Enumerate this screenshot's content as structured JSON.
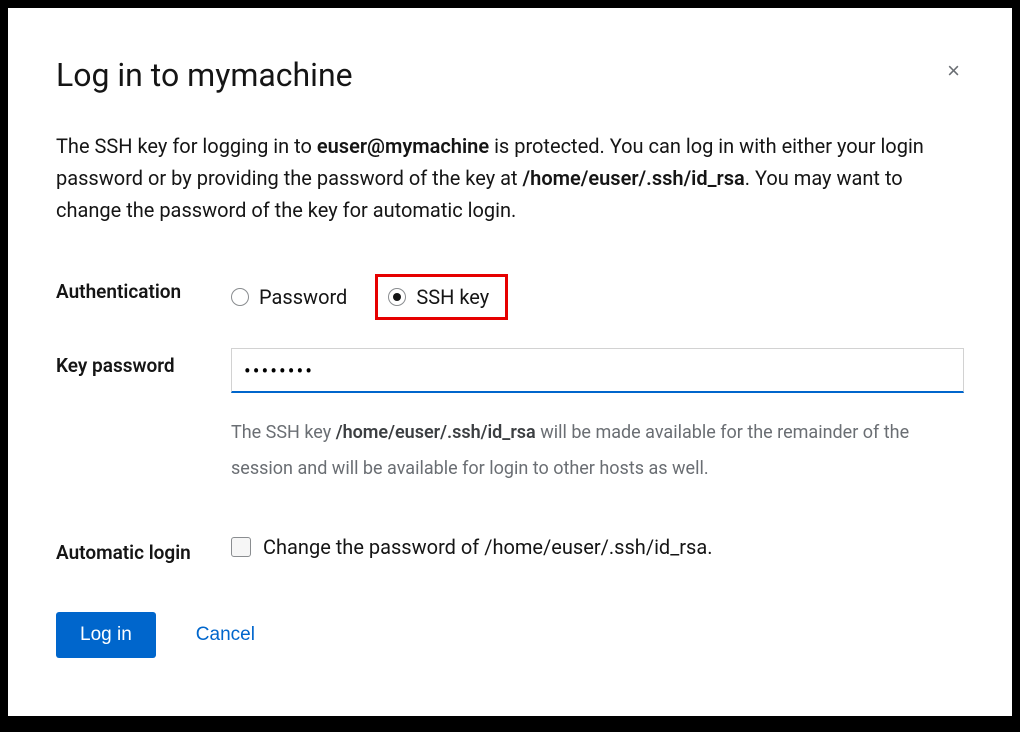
{
  "title": "Log in to mymachine",
  "close_label": "×",
  "description": {
    "prefix": "The SSH key for logging in to ",
    "userhost": "euser@mymachine",
    "mid1": " is protected. You can log in with either your login password or by providing the password of the key at ",
    "keypath": "/home/euser/.ssh/id_rsa",
    "suffix": ". You may want to change the password of the key for automatic login."
  },
  "auth": {
    "label": "Authentication",
    "option_password": "Password",
    "option_sshkey": "SSH key",
    "selected": "sshkey"
  },
  "keypw": {
    "label": "Key password",
    "value": "••••••••",
    "helper_prefix": "The SSH key ",
    "helper_path": "/home/euser/.ssh/id_rsa",
    "helper_suffix": " will be made available for the remainder of the session and will be available for login to other hosts as well."
  },
  "autologin": {
    "label": "Automatic login",
    "checkbox_label": "Change the password of /home/euser/.ssh/id_rsa.",
    "checked": false
  },
  "buttons": {
    "login": "Log in",
    "cancel": "Cancel"
  }
}
